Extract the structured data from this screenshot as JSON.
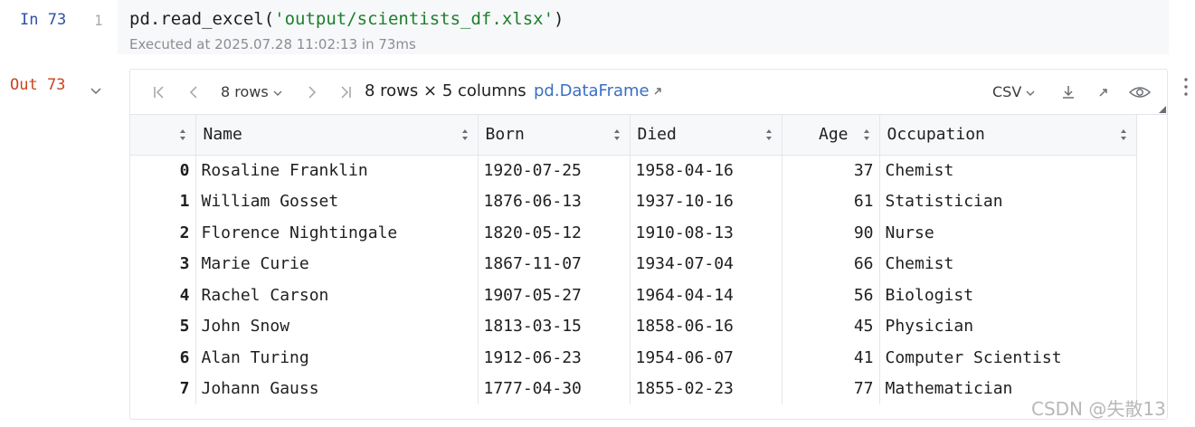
{
  "input_cell": {
    "label": "In 73",
    "line_number": "1",
    "code_prefix": "pd.read_excel(",
    "code_string": "'output/scientists_df.xlsx'",
    "code_suffix": ")",
    "execution_info": "Executed at 2025.07.28 11:02:13 in 73ms"
  },
  "output_cell": {
    "label": "Out 73",
    "toolbar": {
      "rows_select": "8 rows",
      "shape_text": "8 rows × 5 columns",
      "type_link": "pd.DataFrame",
      "export_format": "CSV"
    },
    "columns": [
      "",
      "Name",
      "Born",
      "Died",
      "Age",
      "Occupation"
    ],
    "rows": [
      [
        "0",
        "Rosaline Franklin",
        "1920-07-25",
        "1958-04-16",
        "37",
        "Chemist"
      ],
      [
        "1",
        "William Gosset",
        "1876-06-13",
        "1937-10-16",
        "61",
        "Statistician"
      ],
      [
        "2",
        "Florence Nightingale",
        "1820-05-12",
        "1910-08-13",
        "90",
        "Nurse"
      ],
      [
        "3",
        "Marie Curie",
        "1867-11-07",
        "1934-07-04",
        "66",
        "Chemist"
      ],
      [
        "4",
        "Rachel Carson",
        "1907-05-27",
        "1964-04-14",
        "56",
        "Biologist"
      ],
      [
        "5",
        "John Snow",
        "1813-03-15",
        "1858-06-16",
        "45",
        "Physician"
      ],
      [
        "6",
        "Alan Turing",
        "1912-06-23",
        "1954-06-07",
        "41",
        "Computer Scientist"
      ],
      [
        "7",
        "Johann Gauss",
        "1777-04-30",
        "1855-02-23",
        "77",
        "Mathematician"
      ]
    ]
  },
  "watermark": "CSDN @失散13",
  "colors": {
    "in_label": "#2e4fa3",
    "out_label": "#c9431e",
    "string_literal": "#1e7f2c",
    "link": "#3b6fc2",
    "cell_background": "#f7f8fa"
  }
}
